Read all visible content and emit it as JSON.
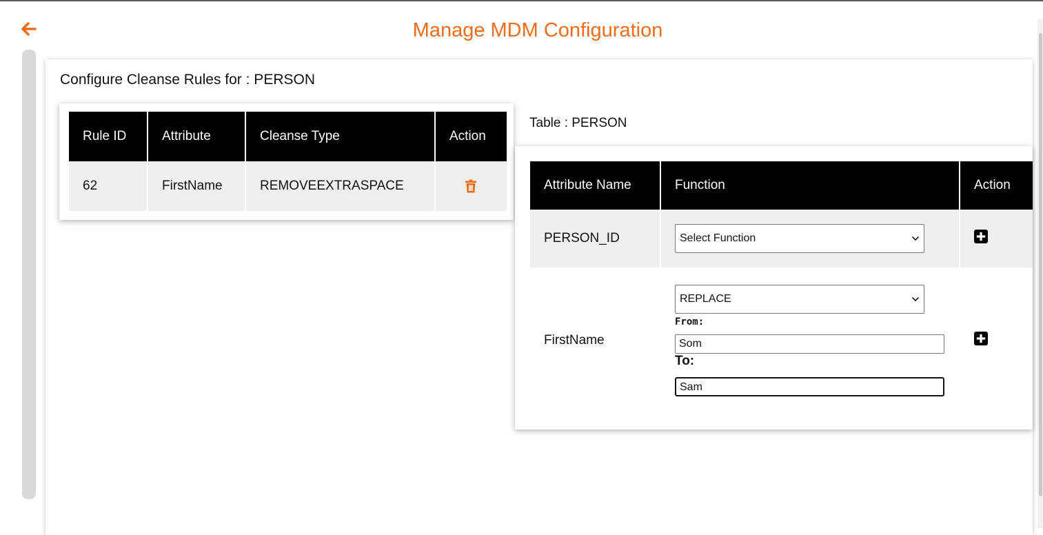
{
  "header": {
    "title": "Manage MDM Configuration",
    "back_icon": "back-arrow-icon",
    "accent_color": "#ef6c1a"
  },
  "section": {
    "heading": "Configure Cleanse Rules for : PERSON"
  },
  "rules_table": {
    "columns": [
      "Rule ID",
      "Attribute",
      "Cleanse Type",
      "Action"
    ],
    "rows": [
      {
        "rule_id": "62",
        "attribute": "FirstName",
        "cleanse_type": "REMOVEEXTRASPACE",
        "action_icon": "trash-icon"
      }
    ]
  },
  "attributes_panel": {
    "table_label": "Table : PERSON",
    "columns": [
      "Attribute Name",
      "Function",
      "Action"
    ],
    "rows": [
      {
        "attribute": "PERSON_ID",
        "function_selected": "Select Function",
        "action_icon": "plus-square-icon"
      },
      {
        "attribute": "FirstName",
        "function_selected": "REPLACE",
        "from_label": "From:",
        "from_value": "Som",
        "to_label": "To:",
        "to_value": "Sam",
        "action_icon": "plus-square-icon"
      }
    ]
  }
}
